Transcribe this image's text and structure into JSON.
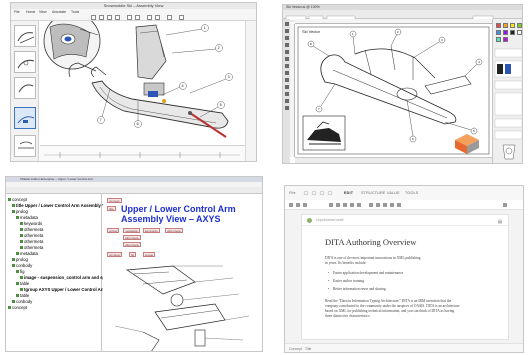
{
  "cad_viewer": {
    "window_title": "Snowmobile Ski – Assembly View",
    "ribbon_tabs": [
      "File",
      "Home",
      "View",
      "Annotate",
      "Tools"
    ],
    "callouts": [
      "1",
      "2",
      "3",
      "4",
      "5",
      "6",
      "7"
    ],
    "thumbnails": 5,
    "selected_thumbnail": 4
  },
  "illustrator": {
    "window_title": "Ski Vector.ai @ 100%",
    "drawing_label": "Ski Vector",
    "swatches": [
      "#e64b4b",
      "#f6a623",
      "#f8e71c",
      "#7ed321",
      "#4a90e2",
      "#9013fe",
      "#222222",
      "#ffffff",
      "#50e3c2",
      "#bd10e0"
    ],
    "callouts": [
      "1",
      "2",
      "3",
      "4",
      "5",
      "6",
      "7",
      "8"
    ]
  },
  "xml_editor": {
    "window_title": "XMetaL Author Enterprise – Upper / Lower Control Arm",
    "menu": [
      "File",
      "Edit",
      "View",
      "Insert",
      "Format",
      "Tools",
      "Table",
      "Window",
      "Help"
    ],
    "tree": [
      {
        "label": "concept",
        "indent": 0
      },
      {
        "label": "title  Upper / Lower Control Arm Assembly View –",
        "indent": 1
      },
      {
        "label": "prolog",
        "indent": 1
      },
      {
        "label": "metadata",
        "indent": 2
      },
      {
        "label": "keywords",
        "indent": 3
      },
      {
        "label": "othermeta",
        "indent": 3
      },
      {
        "label": "othermeta",
        "indent": 3
      },
      {
        "label": "othermeta",
        "indent": 3
      },
      {
        "label": "othermeta",
        "indent": 3
      },
      {
        "label": "metadata",
        "indent": 2
      },
      {
        "label": "prolog",
        "indent": 1
      },
      {
        "label": "conbody",
        "indent": 1
      },
      {
        "label": "fig",
        "indent": 2
      },
      {
        "label": "image - suspension_control arm and spindle_1",
        "indent": 3
      },
      {
        "label": "table",
        "indent": 2
      },
      {
        "label": "tgroup  AXYS Upper / Lower Control Arm",
        "indent": 3
      },
      {
        "label": "table",
        "indent": 2
      },
      {
        "label": "conbody",
        "indent": 1
      },
      {
        "label": "concept",
        "indent": 0
      }
    ],
    "heading": "Upper / Lower Control Arm Assembly View – AXYS",
    "tags": [
      "concept",
      "title",
      "prolog",
      "metadata",
      "keywords",
      "othermeta",
      "conbody",
      "fig",
      "image"
    ]
  },
  "web_editor": {
    "menu": [
      "File",
      "EDIT",
      "STRUCTURE",
      "VALUE",
      "TOOLS"
    ],
    "active_menu": "EDIT",
    "doc_meta": "Unpublished draft",
    "title": "DITA Authoring Overview",
    "intro": [
      "DITA is one of the most important innovations in XML publishing",
      "in years. Its benefits include:"
    ],
    "bullets": [
      "Faster application development and maintenance",
      "Easier author training",
      "Better information reuse and sharing"
    ],
    "body": [
      "Read the \"Darwin Information Typing Architecture,\" DITA is an IBM invention that the",
      "company contributed to the community under the auspices of OASIS. DITA is an architecture",
      "based on XML for publishing technical information, and you can think of DITA as having",
      "three distinctive characteristics."
    ],
    "footer": [
      "Concept",
      "Title"
    ]
  }
}
